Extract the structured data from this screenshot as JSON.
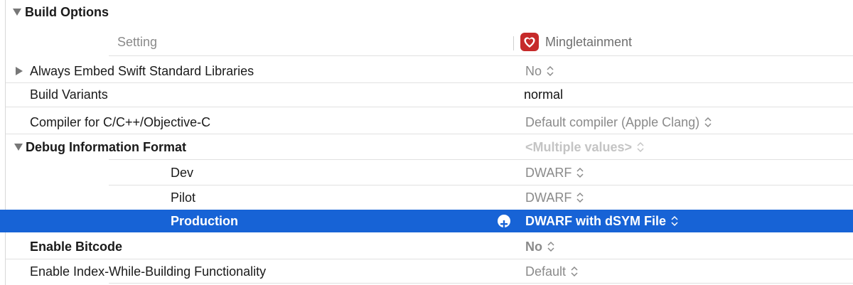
{
  "section": {
    "title": "Build Options"
  },
  "header": {
    "setting_label": "Setting",
    "target_name": "Mingletainment"
  },
  "rows": [
    {
      "label": "Always Embed Swift Standard Libraries",
      "value": "No"
    },
    {
      "label": "Build Variants",
      "value": "normal"
    },
    {
      "label": "Compiler for C/C++/Objective-C",
      "value": "Default compiler (Apple Clang)"
    },
    {
      "label": "Debug Information Format",
      "value": "<Multiple values>"
    },
    {
      "label": "Dev",
      "value": "DWARF"
    },
    {
      "label": "Pilot",
      "value": "DWARF"
    },
    {
      "label": "Production",
      "value": "DWARF with dSYM File"
    },
    {
      "label": "Enable Bitcode",
      "value": "No"
    },
    {
      "label": "Enable Index-While-Building Functionality",
      "value": "Default"
    }
  ],
  "icons": {
    "section_disclosure": "disclosure-triangle-down-icon",
    "collapsed_disclosure": "disclosure-triangle-right-icon",
    "stepper": "up-down-chevron-icon",
    "add": "plus-circle-icon",
    "target": "app-icon"
  },
  "colors": {
    "selection": "#1763d6",
    "value_gray": "#8a8a8a",
    "muted": "#c4c4c4",
    "app_icon": "#c62a2a"
  }
}
